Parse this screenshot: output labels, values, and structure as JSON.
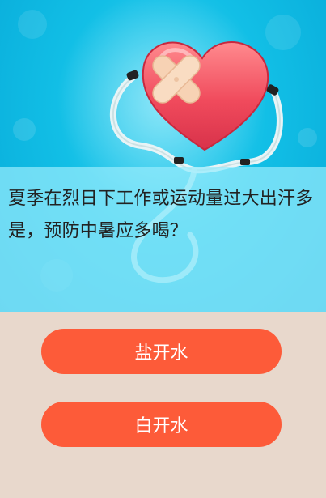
{
  "question": {
    "text": "夏季在烈日下工作或运动量过大出汗多是，预防中暑应多喝？"
  },
  "answers": [
    {
      "label": "盐开水"
    },
    {
      "label": "白开水"
    }
  ],
  "colors": {
    "hero_blue": "#12bfe6",
    "panel_tint": "#96ecfc",
    "page_background": "#e8d8cc",
    "answer_button": "#fd5b39",
    "heart": "#f04a5c"
  },
  "hero": {
    "icon": "heart-stethoscope-bandage-icon"
  }
}
